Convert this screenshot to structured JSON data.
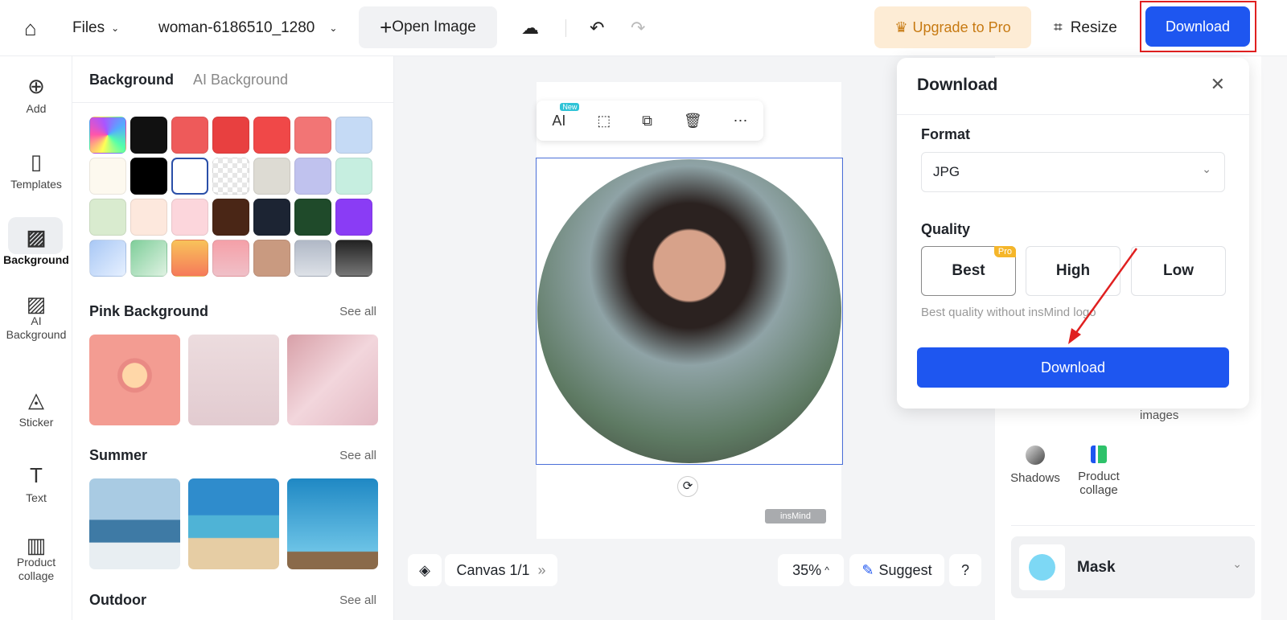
{
  "topbar": {
    "files": "Files",
    "filename": "woman-6186510_1280",
    "open_image": "Open Image",
    "upgrade": "Upgrade to Pro",
    "resize": "Resize",
    "download": "Download"
  },
  "rail": [
    {
      "label": "Add",
      "icon": "plus-circle-icon"
    },
    {
      "label": "Templates",
      "icon": "templates-icon"
    },
    {
      "label": "Background",
      "icon": "background-icon"
    },
    {
      "label": "AI Background",
      "icon": "ai-background-icon"
    },
    {
      "label": "Sticker",
      "icon": "sticker-icon"
    },
    {
      "label": "Text",
      "icon": "text-icon"
    },
    {
      "label": "Product collage",
      "icon": "product-collage-icon"
    }
  ],
  "panel": {
    "tabs": [
      "Background",
      "AI Background"
    ],
    "swatches": [
      "rainbow",
      "#111111",
      "#ee5a5a",
      "#e84040",
      "#f04848",
      "#f27575",
      "#c5daf5",
      "#fdf9ef",
      "#000000",
      "#ffffff",
      "transparent",
      "#dddbd3",
      "#c0c2ee",
      "#c6eee0",
      "#d9ebcf",
      "#fde8dd",
      "#fcd6dc",
      "#4a2616",
      "#1c2433",
      "#1f4a2a",
      "#8a3cf5",
      "grad-blue",
      "grad-green",
      "grad-orange",
      "grad-pink",
      "#c99a80",
      "grad-gray",
      "grad-dark"
    ],
    "sections": [
      {
        "title": "Pink Background",
        "see_all": "See all"
      },
      {
        "title": "Summer",
        "see_all": "See all"
      },
      {
        "title": "Outdoor",
        "see_all": "See all"
      }
    ]
  },
  "canvas": {
    "ai_badge": "New",
    "watermark": "insMind",
    "canvas_label": "Canvas 1/1",
    "zoom": "35%",
    "suggest": "Suggest",
    "help": "?"
  },
  "right": {
    "images": "images",
    "shadows": "Shadows",
    "product_collage": "Product collage",
    "mask": "Mask"
  },
  "popup": {
    "title": "Download",
    "format_label": "Format",
    "format_value": "JPG",
    "quality_label": "Quality",
    "qualities": [
      "Best",
      "High",
      "Low"
    ],
    "pro_badge": "Pro",
    "selected_quality": "Best",
    "hint": "Best quality without insMind logo",
    "download": "Download"
  },
  "colors": {
    "accent": "#1e56f0",
    "upgrade_bg": "#fdecd5",
    "upgrade_text": "#c77a12",
    "annotation": "#e02020"
  }
}
